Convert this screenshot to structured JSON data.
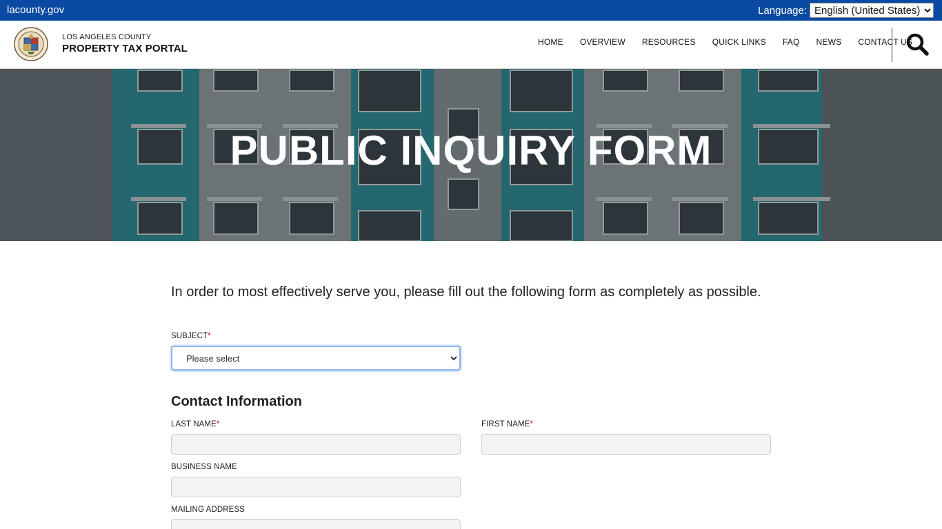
{
  "topbar": {
    "site_link": "lacounty.gov",
    "language_label": "Language:",
    "language_selected": "English (United States)"
  },
  "header": {
    "brand_small": "LOS ANGELES COUNTY",
    "brand_big": "PROPERTY TAX PORTAL",
    "nav": [
      "HOME",
      "OVERVIEW",
      "RESOURCES",
      "QUICK LINKS",
      "FAQ",
      "NEWS",
      "CONTACT US"
    ]
  },
  "hero": {
    "title": "PUBLIC INQUIRY FORM"
  },
  "form": {
    "intro": "In order to most effectively serve you, please fill out the following form as completely as possible.",
    "subject_label": "SUBJECT",
    "required_mark": "*",
    "subject_value": "Please select",
    "contact_section_title": "Contact Information",
    "last_name_label": "LAST NAME",
    "first_name_label": "FIRST NAME",
    "business_name_label": "BUSINESS NAME",
    "mailing_address_label": "MAILING ADDRESS"
  },
  "colors": {
    "topbar": "#0b4aa2",
    "required": "#cc0000",
    "focus_border": "#8ab4f0"
  }
}
